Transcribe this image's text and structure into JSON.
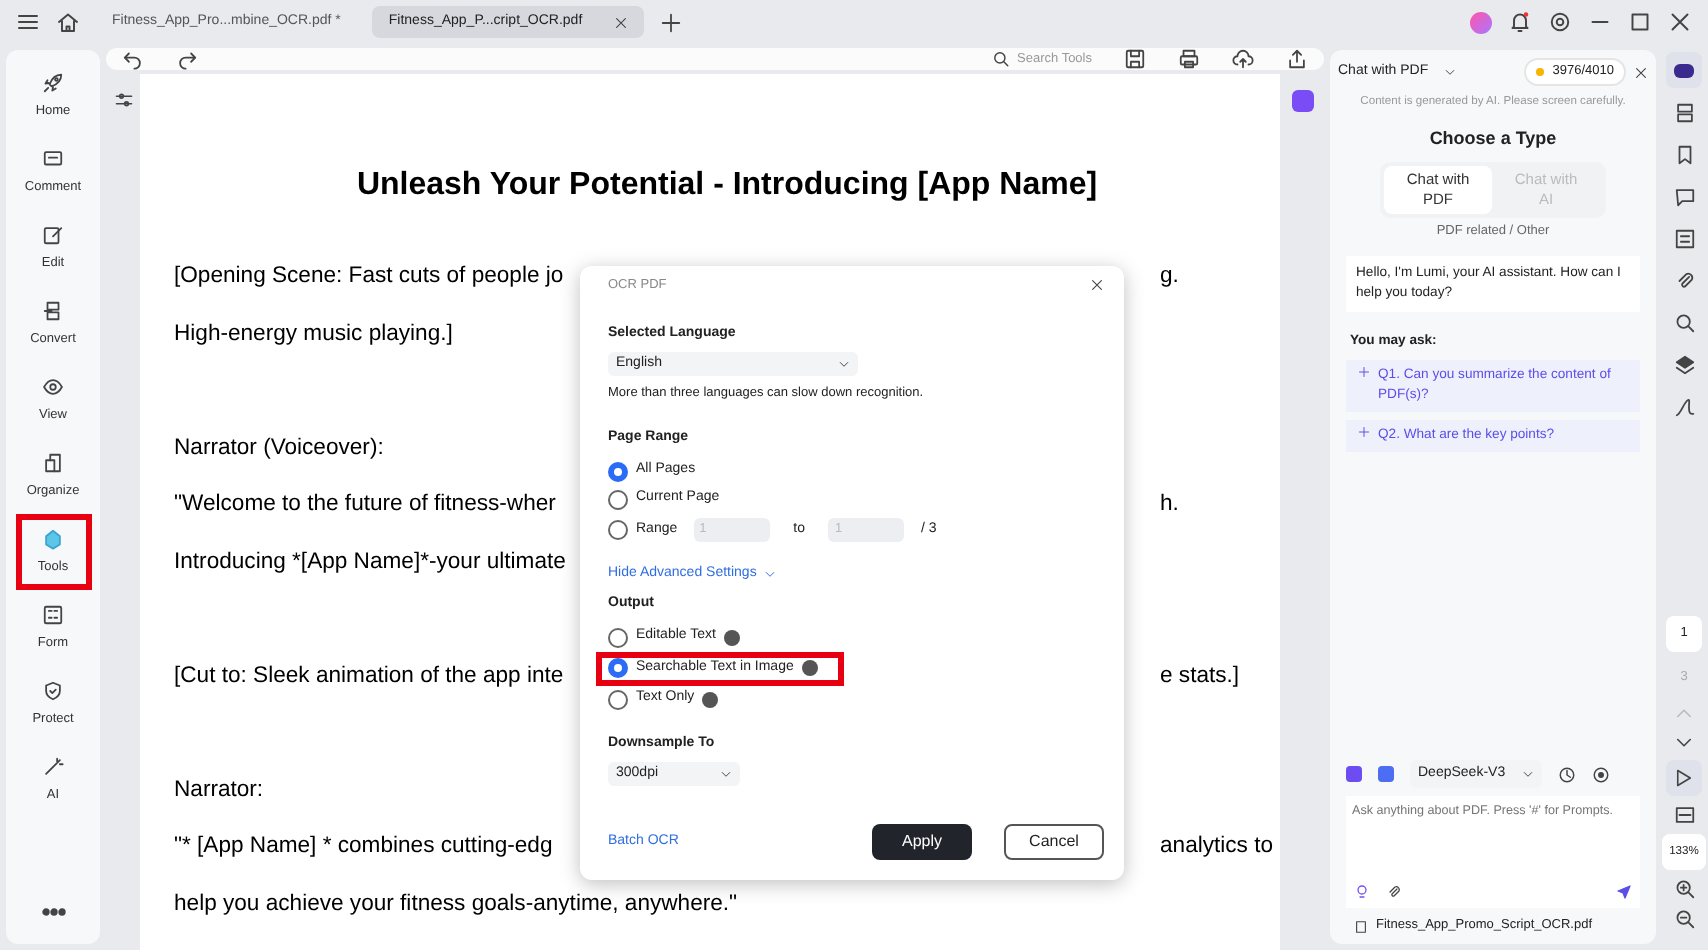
{
  "tabs": [
    {
      "label": "Fitness_App_Pro...mbine_OCR.pdf *",
      "selected": false
    },
    {
      "label": "Fitness_App_P...cript_OCR.pdf",
      "selected": true
    }
  ],
  "sidebar": {
    "items": [
      {
        "label": "Home",
        "highlighted": false
      },
      {
        "label": "Comment",
        "highlighted": false
      },
      {
        "label": "Edit",
        "highlighted": false
      },
      {
        "label": "Convert",
        "highlighted": false
      },
      {
        "label": "View",
        "highlighted": false
      },
      {
        "label": "Organize",
        "highlighted": false
      },
      {
        "label": "Tools",
        "highlighted": true
      },
      {
        "label": "Form",
        "highlighted": false
      },
      {
        "label": "Protect",
        "highlighted": false
      },
      {
        "label": "AI",
        "highlighted": false
      }
    ]
  },
  "toolbar": {
    "search": {
      "placeholder": "Search Tools"
    }
  },
  "document": {
    "title": "Unleash Your Potential - Introducing [App Name]",
    "paragraphs": [
      [
        {
          "left": "[Opening Scene: Fast cuts of people jo",
          "right": "g."
        },
        {
          "left": "High-energy music playing.]"
        }
      ],
      [
        {
          "left": "Narrator (Voiceover):"
        },
        {
          "left": "\"Welcome to the future of fitness-wher",
          "right": "h."
        },
        {
          "left": "Introducing *[App Name]*-your ultimate"
        }
      ],
      [
        {
          "left": "[Cut to: Sleek animation of the app inte",
          "right": "e stats.]"
        }
      ],
      [
        {
          "left": "Narrator:"
        },
        {
          "left": "\"* [App Name] * combines cutting-edg",
          "right": "analytics to"
        },
        {
          "left": "help you achieve your fitness goals-anytime, anywhere.\""
        }
      ]
    ]
  },
  "dialog": {
    "title": "OCR PDF",
    "language_label": "Selected Language",
    "language": "English",
    "language_note": "More than three languages can slow down recognition.",
    "page_range_label": "Page Range",
    "page_options": [
      {
        "kind": "plain",
        "label": "All Pages",
        "selected": true
      },
      {
        "kind": "plain",
        "label": "Current Page",
        "selected": false
      },
      {
        "kind": "range",
        "label": "Range",
        "selected": false,
        "from": "1",
        "to_label": "to",
        "to": "1",
        "total": "/ 3"
      }
    ],
    "advanced_link": "Hide Advanced Settings",
    "output_label": "Output",
    "output_options": [
      {
        "label": "Editable Text",
        "selected": false,
        "highlighted": false
      },
      {
        "label": "Searchable Text in Image",
        "selected": true,
        "highlighted": true
      },
      {
        "label": "Text Only",
        "selected": false,
        "highlighted": false
      }
    ],
    "downsample_label": "Downsample To",
    "downsample": "300dpi",
    "batch_link": "Batch OCR",
    "apply": "Apply",
    "cancel": "Cancel"
  },
  "chat": {
    "mode": "Chat with PDF",
    "credits": "3976/4010",
    "notice": "Content is generated by AI. Please screen carefully.",
    "choose_title": "Choose a Type",
    "types": [
      {
        "label": "Chat with PDF",
        "selected": true
      },
      {
        "label": "Chat with AI",
        "selected": false
      }
    ],
    "type_note": "PDF related / Other",
    "greeting": "Hello, I'm Lumi, your AI assistant. How can I help you today?",
    "ask_title": "You may ask:",
    "suggestions": [
      "Q1. Can you summarize the content of PDF(s)?",
      "Q2. What are the key points?"
    ],
    "model": "DeepSeek-V3",
    "input": {
      "placeholder": "Ask anything about PDF. Press '#' for Prompts."
    },
    "file": "Fitness_App_Promo_Script_OCR.pdf"
  },
  "rail": {
    "page_current": "1",
    "page_total": "3",
    "zoom": "133%"
  }
}
